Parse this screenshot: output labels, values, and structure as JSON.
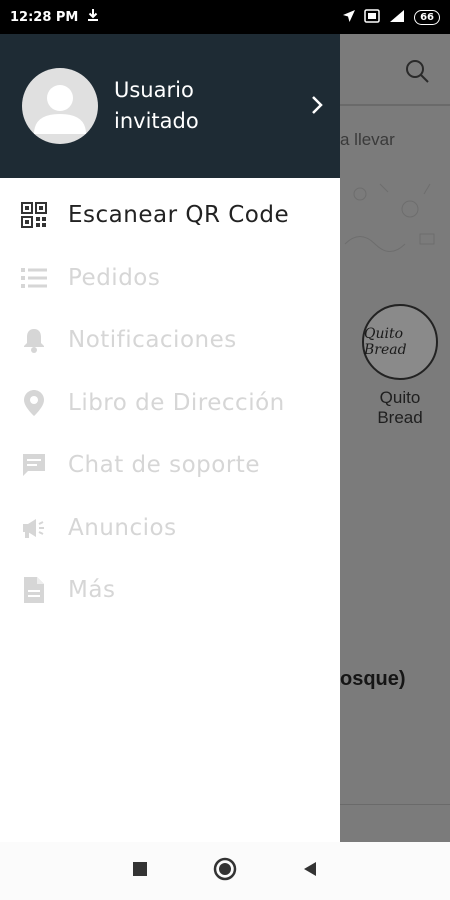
{
  "status_bar": {
    "time": "12:28 PM",
    "battery": "66"
  },
  "background": {
    "tab_partial": "a llevar",
    "store_name_line1": "Quito",
    "store_name_line2": "Bread",
    "item_partial": "osque)"
  },
  "drawer": {
    "user_name_line1": "Usuario",
    "user_name_line2": "invitado",
    "items": [
      {
        "label": "Escanear QR Code",
        "icon": "qr-code-icon",
        "active": true
      },
      {
        "label": "Pedidos",
        "icon": "list-icon",
        "active": false
      },
      {
        "label": "Notificaciones",
        "icon": "bell-icon",
        "active": false
      },
      {
        "label": "Libro de Dirección",
        "icon": "location-pin-icon",
        "active": false
      },
      {
        "label": "Chat de soporte",
        "icon": "chat-icon",
        "active": false
      },
      {
        "label": "Anuncios",
        "icon": "megaphone-icon",
        "active": false
      },
      {
        "label": "Más",
        "icon": "document-icon",
        "active": false
      }
    ]
  },
  "colors": {
    "header_bg": "#1e2b34",
    "active_text": "#222222",
    "disabled_text": "#d6d6d6",
    "overlay": "#7b7b7b"
  }
}
